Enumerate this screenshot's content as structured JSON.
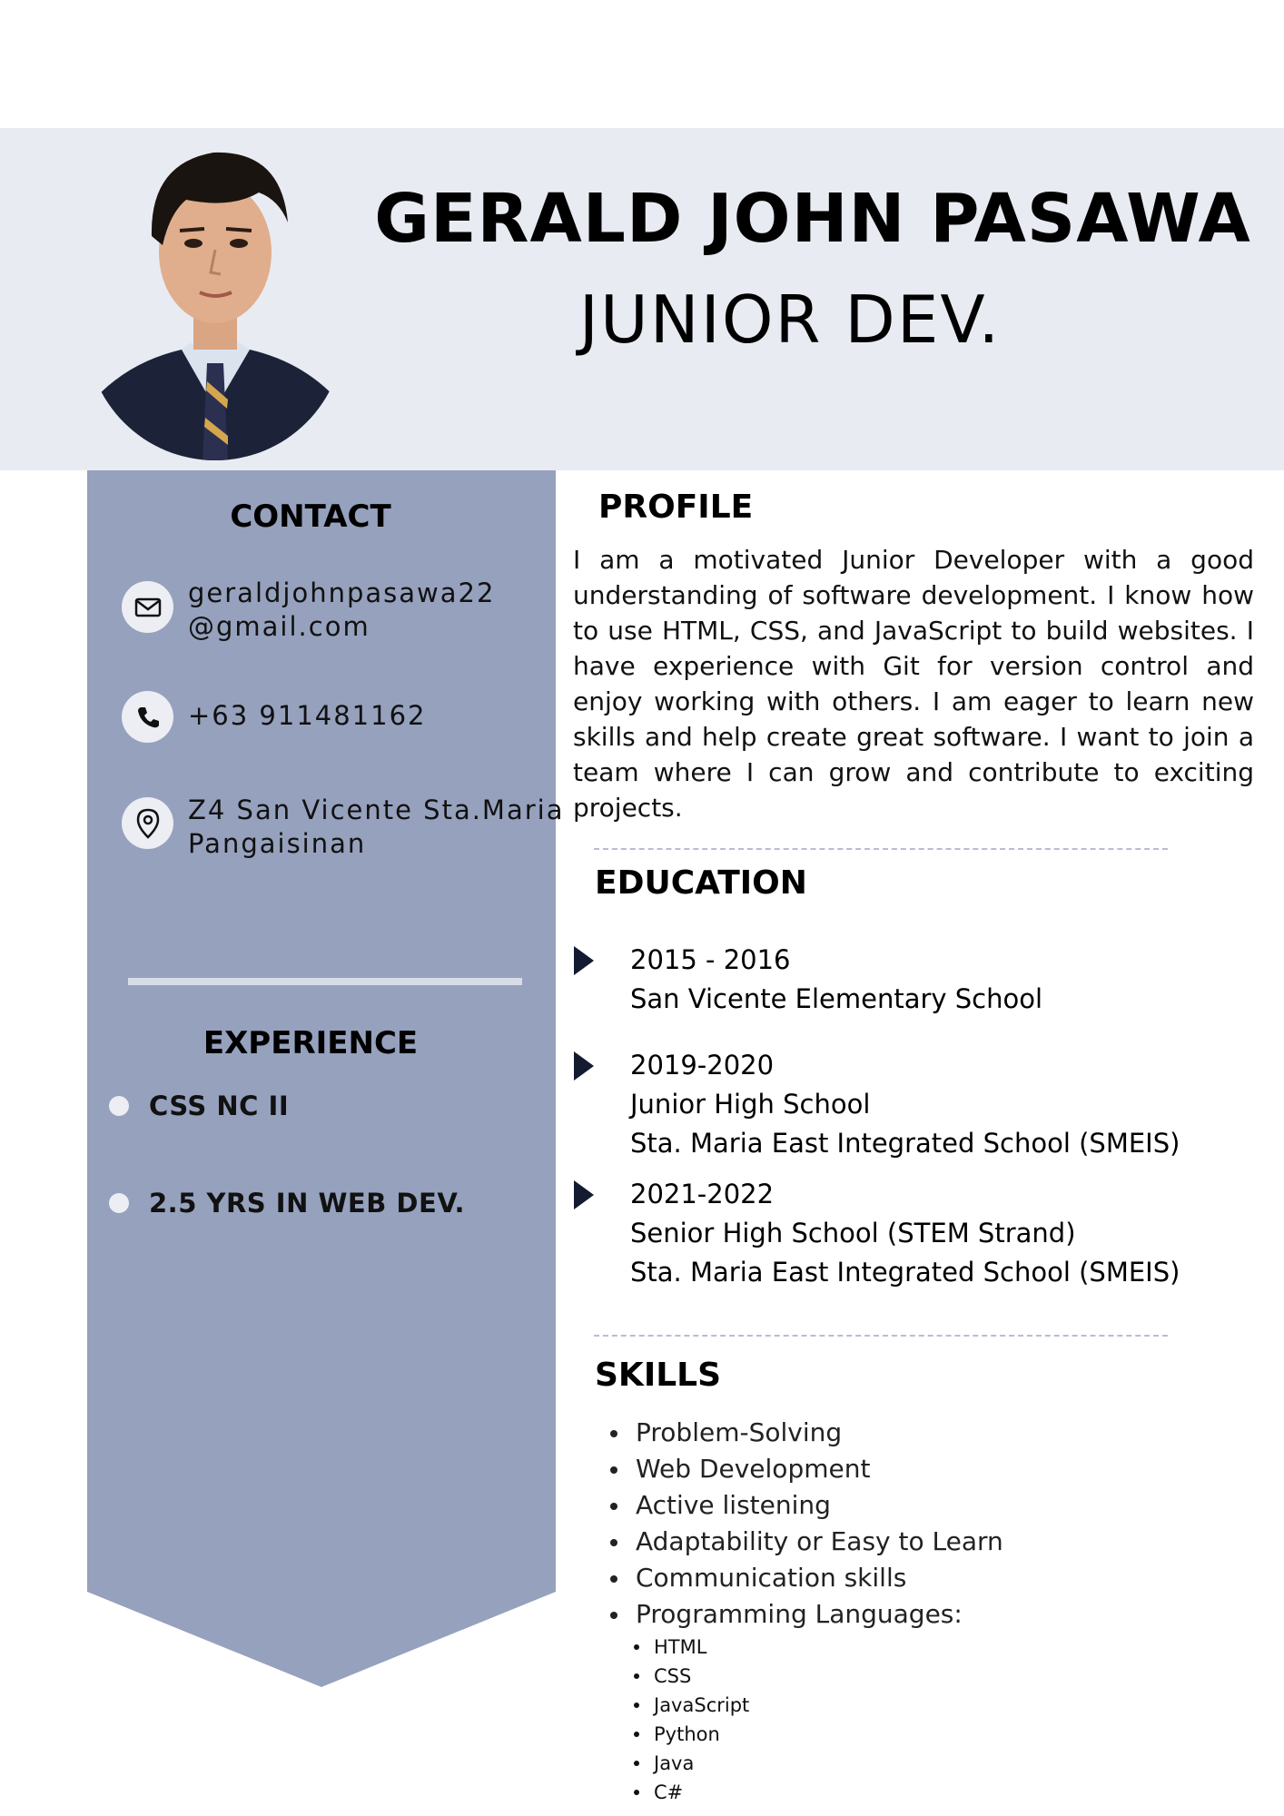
{
  "header": {
    "name": "GERALD JOHN PASAWA",
    "role": "JUNIOR DEV."
  },
  "colors": {
    "header_band": "#e8ebf2",
    "sidebar": "#96a1bd",
    "accent_dark": "#141a30"
  },
  "contact": {
    "heading": "CONTACT",
    "email": "geraldjohnpasawa22\n@gmail.com",
    "phone": "+63 911481162",
    "address": "Z4 San Vicente Sta.Maria\nPangaisinan"
  },
  "experience": {
    "heading": "EXPERIENCE",
    "items": [
      "CSS NC II",
      "2.5 YRS IN WEB DEV."
    ]
  },
  "profile": {
    "heading": "PROFILE",
    "text": "I am a motivated Junior Developer with a good understanding of software development. I know how to use HTML, CSS, and JavaScript to build websites. I have experience with Git for version control and enjoy working with others. I am eager to learn new skills and help create great software. I want to join a team where I can grow and contribute to exciting projects."
  },
  "education": {
    "heading": "EDUCATION",
    "items": [
      {
        "years": "2015 - 2016",
        "lines": [
          "San Vicente Elementary School"
        ]
      },
      {
        "years": "2019-2020",
        "lines": [
          "Junior High School",
          "Sta. Maria East Integrated School (SMEIS)"
        ]
      },
      {
        "years": "2021-2022",
        "lines": [
          "Senior High School (STEM Strand)",
          "Sta. Maria East Integrated School (SMEIS)"
        ]
      }
    ]
  },
  "skills": {
    "heading": "SKILLS",
    "items": [
      "Problem-Solving",
      "Web Development",
      "Active listening",
      "Adaptability or Easy to Learn",
      "Communication skills",
      "Programming Languages:"
    ],
    "languages": [
      "HTML",
      "CSS",
      "JavaScript",
      "Python",
      "Java",
      "C#"
    ]
  }
}
